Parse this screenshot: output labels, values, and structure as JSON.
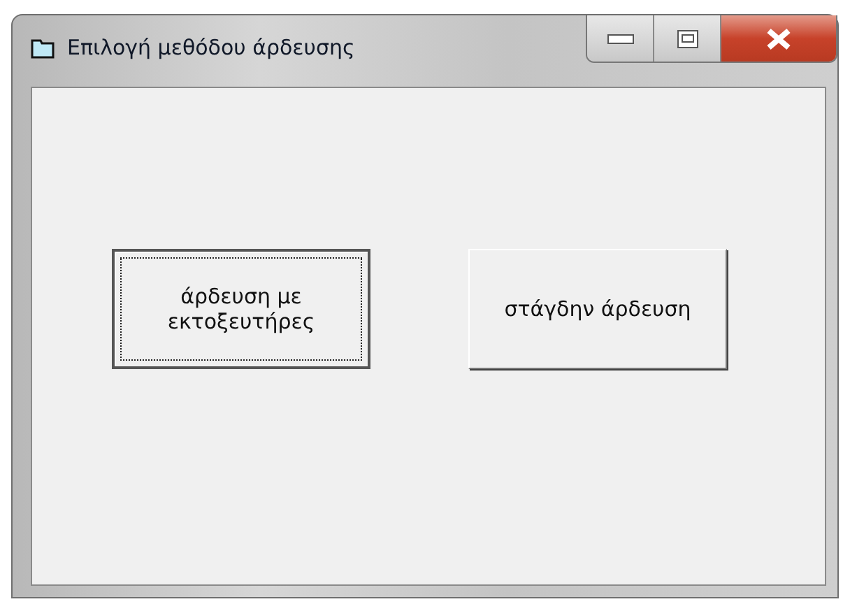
{
  "window": {
    "title": "Επιλογή μεθόδου άρδευσης"
  },
  "buttons": [
    {
      "label": "άρδευση με εκτοξευτήρες",
      "focused": true
    },
    {
      "label": "στάγδην άρδευση",
      "focused": false
    }
  ]
}
